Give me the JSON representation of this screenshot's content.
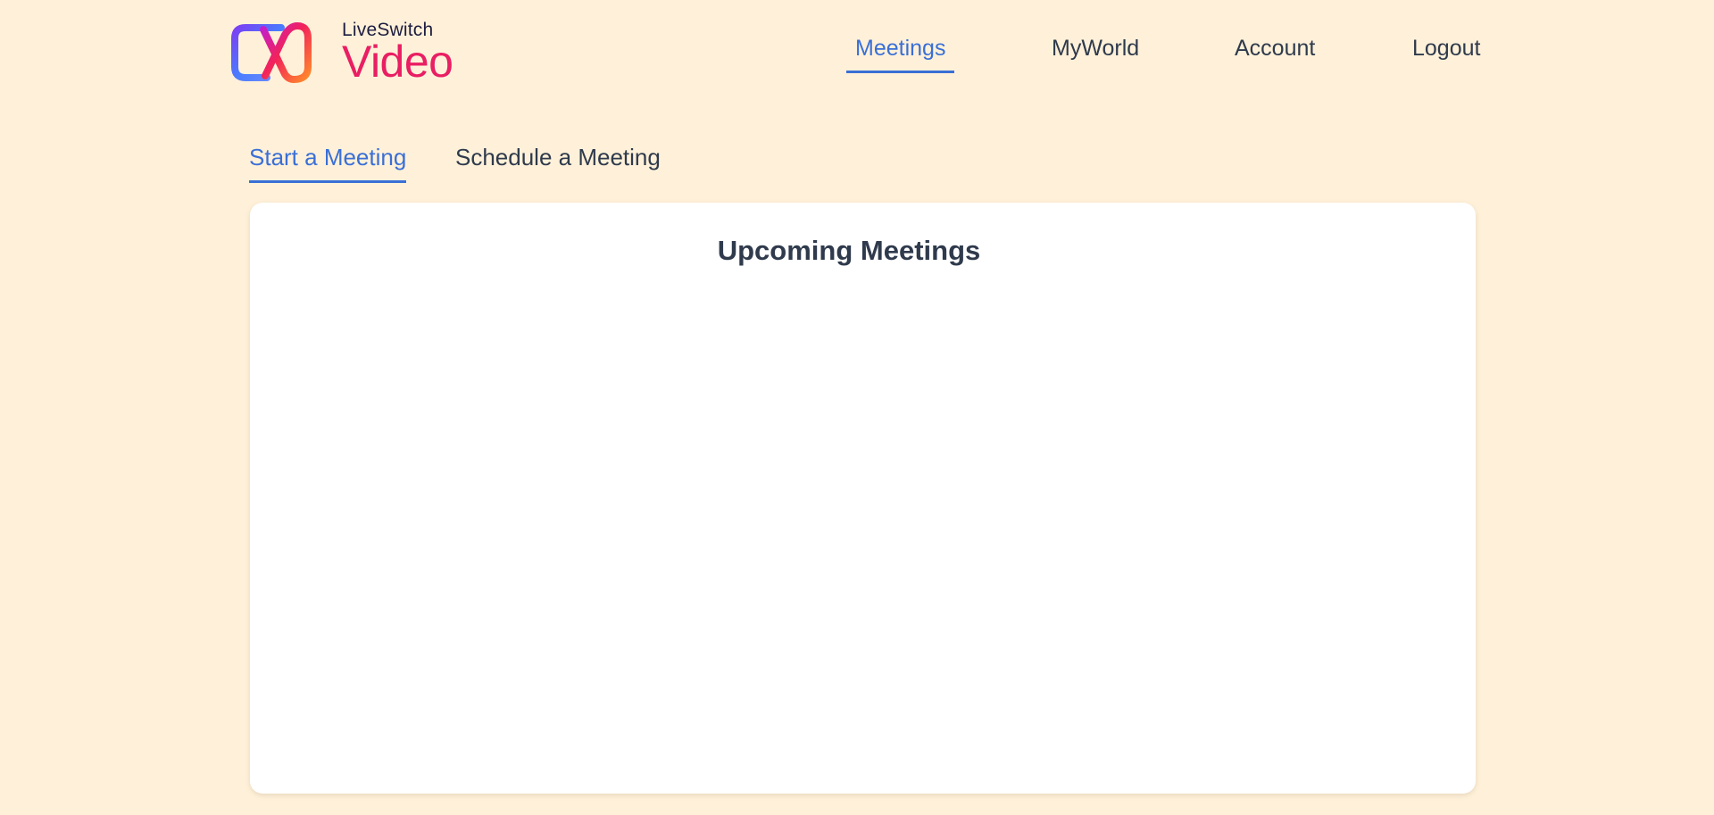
{
  "brand": {
    "small_text": "LiveSwitch",
    "big_text": "Video",
    "logo_icon": "liveswitch-logo-icon"
  },
  "nav": {
    "items": [
      {
        "label": "Meetings",
        "active": true
      },
      {
        "label": "MyWorld",
        "active": false
      },
      {
        "label": "Account",
        "active": false
      },
      {
        "label": "Logout",
        "active": false
      }
    ]
  },
  "tabs": [
    {
      "label": "Start a Meeting",
      "active": true
    },
    {
      "label": "Schedule a Meeting",
      "active": false
    }
  ],
  "card": {
    "title": "Upcoming Meetings"
  },
  "colors": {
    "background": "#fff1d9",
    "accent": "#3a6fd6",
    "brand_pink": "#e91e63",
    "text": "#2f3a4c"
  }
}
